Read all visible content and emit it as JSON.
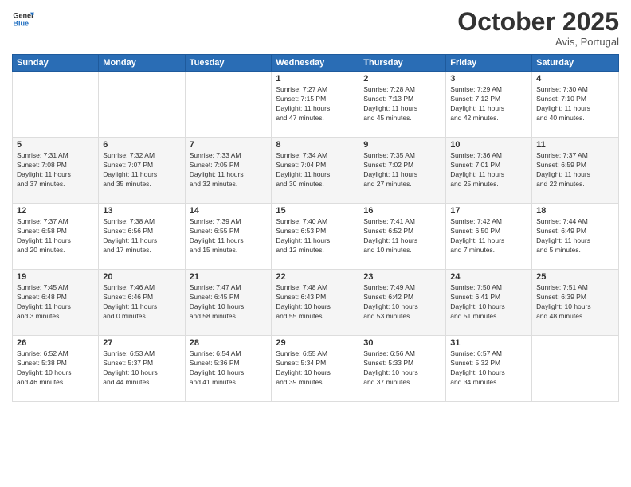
{
  "logo": {
    "general": "General",
    "blue": "Blue"
  },
  "header": {
    "month": "October 2025",
    "location": "Avis, Portugal"
  },
  "days_of_week": [
    "Sunday",
    "Monday",
    "Tuesday",
    "Wednesday",
    "Thursday",
    "Friday",
    "Saturday"
  ],
  "weeks": [
    [
      {
        "day": "",
        "info": ""
      },
      {
        "day": "",
        "info": ""
      },
      {
        "day": "",
        "info": ""
      },
      {
        "day": "1",
        "info": "Sunrise: 7:27 AM\nSunset: 7:15 PM\nDaylight: 11 hours\nand 47 minutes."
      },
      {
        "day": "2",
        "info": "Sunrise: 7:28 AM\nSunset: 7:13 PM\nDaylight: 11 hours\nand 45 minutes."
      },
      {
        "day": "3",
        "info": "Sunrise: 7:29 AM\nSunset: 7:12 PM\nDaylight: 11 hours\nand 42 minutes."
      },
      {
        "day": "4",
        "info": "Sunrise: 7:30 AM\nSunset: 7:10 PM\nDaylight: 11 hours\nand 40 minutes."
      }
    ],
    [
      {
        "day": "5",
        "info": "Sunrise: 7:31 AM\nSunset: 7:08 PM\nDaylight: 11 hours\nand 37 minutes."
      },
      {
        "day": "6",
        "info": "Sunrise: 7:32 AM\nSunset: 7:07 PM\nDaylight: 11 hours\nand 35 minutes."
      },
      {
        "day": "7",
        "info": "Sunrise: 7:33 AM\nSunset: 7:05 PM\nDaylight: 11 hours\nand 32 minutes."
      },
      {
        "day": "8",
        "info": "Sunrise: 7:34 AM\nSunset: 7:04 PM\nDaylight: 11 hours\nand 30 minutes."
      },
      {
        "day": "9",
        "info": "Sunrise: 7:35 AM\nSunset: 7:02 PM\nDaylight: 11 hours\nand 27 minutes."
      },
      {
        "day": "10",
        "info": "Sunrise: 7:36 AM\nSunset: 7:01 PM\nDaylight: 11 hours\nand 25 minutes."
      },
      {
        "day": "11",
        "info": "Sunrise: 7:37 AM\nSunset: 6:59 PM\nDaylight: 11 hours\nand 22 minutes."
      }
    ],
    [
      {
        "day": "12",
        "info": "Sunrise: 7:37 AM\nSunset: 6:58 PM\nDaylight: 11 hours\nand 20 minutes."
      },
      {
        "day": "13",
        "info": "Sunrise: 7:38 AM\nSunset: 6:56 PM\nDaylight: 11 hours\nand 17 minutes."
      },
      {
        "day": "14",
        "info": "Sunrise: 7:39 AM\nSunset: 6:55 PM\nDaylight: 11 hours\nand 15 minutes."
      },
      {
        "day": "15",
        "info": "Sunrise: 7:40 AM\nSunset: 6:53 PM\nDaylight: 11 hours\nand 12 minutes."
      },
      {
        "day": "16",
        "info": "Sunrise: 7:41 AM\nSunset: 6:52 PM\nDaylight: 11 hours\nand 10 minutes."
      },
      {
        "day": "17",
        "info": "Sunrise: 7:42 AM\nSunset: 6:50 PM\nDaylight: 11 hours\nand 7 minutes."
      },
      {
        "day": "18",
        "info": "Sunrise: 7:44 AM\nSunset: 6:49 PM\nDaylight: 11 hours\nand 5 minutes."
      }
    ],
    [
      {
        "day": "19",
        "info": "Sunrise: 7:45 AM\nSunset: 6:48 PM\nDaylight: 11 hours\nand 3 minutes."
      },
      {
        "day": "20",
        "info": "Sunrise: 7:46 AM\nSunset: 6:46 PM\nDaylight: 11 hours\nand 0 minutes."
      },
      {
        "day": "21",
        "info": "Sunrise: 7:47 AM\nSunset: 6:45 PM\nDaylight: 10 hours\nand 58 minutes."
      },
      {
        "day": "22",
        "info": "Sunrise: 7:48 AM\nSunset: 6:43 PM\nDaylight: 10 hours\nand 55 minutes."
      },
      {
        "day": "23",
        "info": "Sunrise: 7:49 AM\nSunset: 6:42 PM\nDaylight: 10 hours\nand 53 minutes."
      },
      {
        "day": "24",
        "info": "Sunrise: 7:50 AM\nSunset: 6:41 PM\nDaylight: 10 hours\nand 51 minutes."
      },
      {
        "day": "25",
        "info": "Sunrise: 7:51 AM\nSunset: 6:39 PM\nDaylight: 10 hours\nand 48 minutes."
      }
    ],
    [
      {
        "day": "26",
        "info": "Sunrise: 6:52 AM\nSunset: 5:38 PM\nDaylight: 10 hours\nand 46 minutes."
      },
      {
        "day": "27",
        "info": "Sunrise: 6:53 AM\nSunset: 5:37 PM\nDaylight: 10 hours\nand 44 minutes."
      },
      {
        "day": "28",
        "info": "Sunrise: 6:54 AM\nSunset: 5:36 PM\nDaylight: 10 hours\nand 41 minutes."
      },
      {
        "day": "29",
        "info": "Sunrise: 6:55 AM\nSunset: 5:34 PM\nDaylight: 10 hours\nand 39 minutes."
      },
      {
        "day": "30",
        "info": "Sunrise: 6:56 AM\nSunset: 5:33 PM\nDaylight: 10 hours\nand 37 minutes."
      },
      {
        "day": "31",
        "info": "Sunrise: 6:57 AM\nSunset: 5:32 PM\nDaylight: 10 hours\nand 34 minutes."
      },
      {
        "day": "",
        "info": ""
      }
    ]
  ]
}
